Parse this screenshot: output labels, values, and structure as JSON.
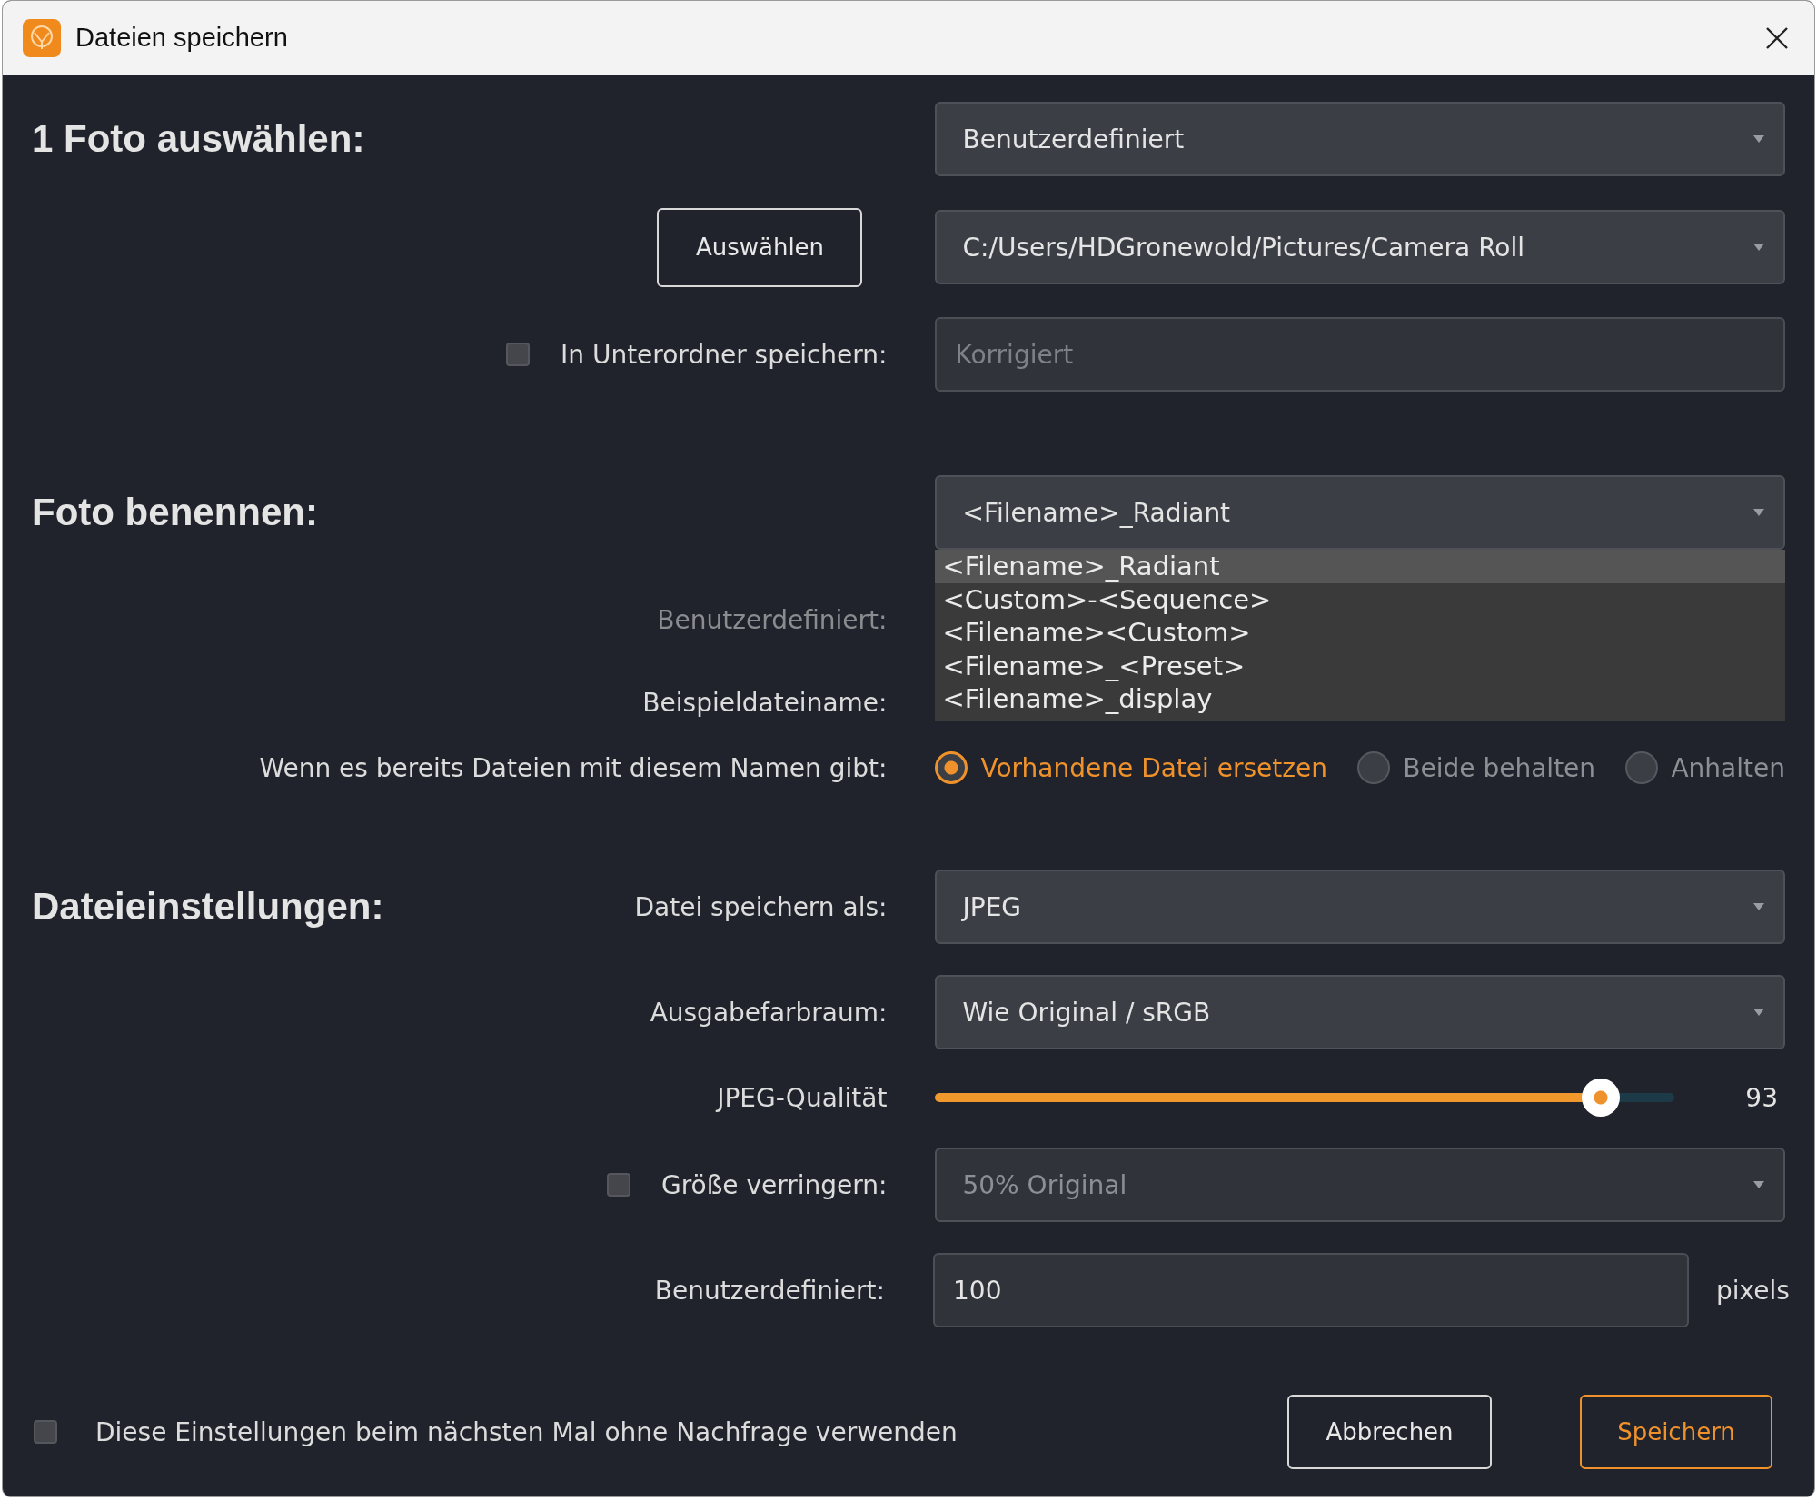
{
  "window": {
    "title": "Dateien speichern"
  },
  "rows": [
    {
      "kind": "dropdown",
      "heading": "1 Foto auswählen:",
      "value": "Benutzerdefiniert"
    },
    {
      "kind": "dropdown",
      "button": "Auswählen",
      "value": "C:/Users/HDGronewold/Pictures/Camera Roll"
    },
    {
      "kind": "text",
      "checkbox": {
        "checked": false
      },
      "label": "In Unterordner speichern:",
      "placeholder": "Korrigiert"
    },
    {
      "kind": "dropdown",
      "heading": "Foto benennen:",
      "value": "<Filename>_Radiant",
      "expanded": true,
      "options": [
        {
          "label": "<Filename>_Radiant",
          "selected": true
        },
        {
          "label": "<Custom>-<Sequence>",
          "selected": false
        },
        {
          "label": "<Filename><Custom>",
          "selected": false
        },
        {
          "label": "<Filename>_<Preset>",
          "selected": false
        },
        {
          "label": "<Filename>_display",
          "selected": false
        }
      ]
    },
    {
      "kind": "covered",
      "label": "Benutzerdefiniert:",
      "disabled": true
    },
    {
      "kind": "covered",
      "label": "Beispieldateiname:",
      "disabled": false
    },
    {
      "kind": "radio",
      "label": "Wenn es bereits Dateien mit diesem Namen gibt:",
      "options": [
        {
          "label": "Vorhandene Datei ersetzen",
          "selected": true
        },
        {
          "label": "Beide behalten",
          "selected": false
        },
        {
          "label": "Anhalten",
          "selected": false
        }
      ]
    },
    {
      "kind": "dropdown",
      "heading": "Dateieinstellungen:",
      "label": "Datei speichern als:",
      "value": "JPEG"
    },
    {
      "kind": "dropdown",
      "label": "Ausgabefarbraum:",
      "value": "Wie Original / sRGB"
    },
    {
      "kind": "slider",
      "label": "JPEG-Qualität",
      "level": 0.9,
      "reading": "93"
    },
    {
      "kind": "dropdown",
      "checkbox": {
        "checked": false
      },
      "label": "Größe verringern:",
      "value": "50% Original",
      "disabled": true
    },
    {
      "kind": "text",
      "label": "Benutzerdefiniert:",
      "value": "100",
      "unit": "pixels"
    }
  ],
  "footer": {
    "checkbox": {
      "checked": false
    },
    "label": "Diese Einstellungen beim nächsten Mal ohne Nachfrage verwenden",
    "buttons": [
      {
        "label": "Abbrechen",
        "kind": "secondary"
      },
      {
        "label": "Speichern",
        "kind": "primary"
      }
    ]
  }
}
